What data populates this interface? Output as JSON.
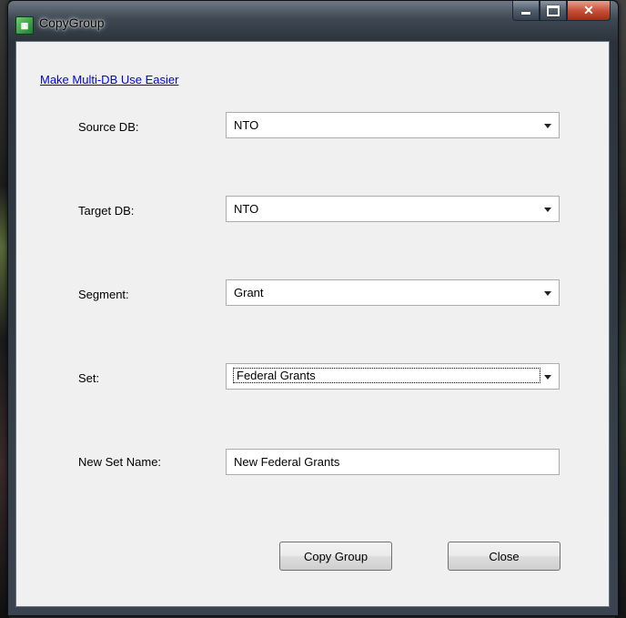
{
  "window": {
    "title": "CopyGroup",
    "icon_name": "app-grid-icon",
    "controls": {
      "minimize": "minimize-icon",
      "maximize": "maximize-icon",
      "close": "✕"
    }
  },
  "link": {
    "label": "Make Multi-DB Use Easier"
  },
  "fields": {
    "source_db": {
      "label": "Source DB:",
      "value": "NTO"
    },
    "target_db": {
      "label": "Target DB:",
      "value": "NTO"
    },
    "segment": {
      "label": "Segment:",
      "value": "Grant"
    },
    "set": {
      "label": "Set:",
      "value": "Federal Grants"
    },
    "new_set_name": {
      "label": "New Set Name:",
      "value": "New Federal Grants"
    }
  },
  "buttons": {
    "copy": "Copy Group",
    "close": "Close"
  }
}
